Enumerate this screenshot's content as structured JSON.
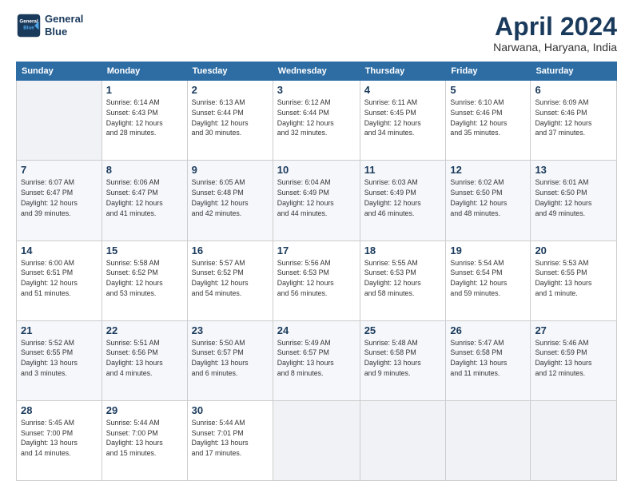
{
  "header": {
    "logo_line1": "General",
    "logo_line2": "Blue",
    "month": "April 2024",
    "location": "Narwana, Haryana, India"
  },
  "weekdays": [
    "Sunday",
    "Monday",
    "Tuesday",
    "Wednesday",
    "Thursday",
    "Friday",
    "Saturday"
  ],
  "weeks": [
    [
      {
        "day": "",
        "info": ""
      },
      {
        "day": "1",
        "info": "Sunrise: 6:14 AM\nSunset: 6:43 PM\nDaylight: 12 hours\nand 28 minutes."
      },
      {
        "day": "2",
        "info": "Sunrise: 6:13 AM\nSunset: 6:44 PM\nDaylight: 12 hours\nand 30 minutes."
      },
      {
        "day": "3",
        "info": "Sunrise: 6:12 AM\nSunset: 6:44 PM\nDaylight: 12 hours\nand 32 minutes."
      },
      {
        "day": "4",
        "info": "Sunrise: 6:11 AM\nSunset: 6:45 PM\nDaylight: 12 hours\nand 34 minutes."
      },
      {
        "day": "5",
        "info": "Sunrise: 6:10 AM\nSunset: 6:46 PM\nDaylight: 12 hours\nand 35 minutes."
      },
      {
        "day": "6",
        "info": "Sunrise: 6:09 AM\nSunset: 6:46 PM\nDaylight: 12 hours\nand 37 minutes."
      }
    ],
    [
      {
        "day": "7",
        "info": "Sunrise: 6:07 AM\nSunset: 6:47 PM\nDaylight: 12 hours\nand 39 minutes."
      },
      {
        "day": "8",
        "info": "Sunrise: 6:06 AM\nSunset: 6:47 PM\nDaylight: 12 hours\nand 41 minutes."
      },
      {
        "day": "9",
        "info": "Sunrise: 6:05 AM\nSunset: 6:48 PM\nDaylight: 12 hours\nand 42 minutes."
      },
      {
        "day": "10",
        "info": "Sunrise: 6:04 AM\nSunset: 6:49 PM\nDaylight: 12 hours\nand 44 minutes."
      },
      {
        "day": "11",
        "info": "Sunrise: 6:03 AM\nSunset: 6:49 PM\nDaylight: 12 hours\nand 46 minutes."
      },
      {
        "day": "12",
        "info": "Sunrise: 6:02 AM\nSunset: 6:50 PM\nDaylight: 12 hours\nand 48 minutes."
      },
      {
        "day": "13",
        "info": "Sunrise: 6:01 AM\nSunset: 6:50 PM\nDaylight: 12 hours\nand 49 minutes."
      }
    ],
    [
      {
        "day": "14",
        "info": "Sunrise: 6:00 AM\nSunset: 6:51 PM\nDaylight: 12 hours\nand 51 minutes."
      },
      {
        "day": "15",
        "info": "Sunrise: 5:58 AM\nSunset: 6:52 PM\nDaylight: 12 hours\nand 53 minutes."
      },
      {
        "day": "16",
        "info": "Sunrise: 5:57 AM\nSunset: 6:52 PM\nDaylight: 12 hours\nand 54 minutes."
      },
      {
        "day": "17",
        "info": "Sunrise: 5:56 AM\nSunset: 6:53 PM\nDaylight: 12 hours\nand 56 minutes."
      },
      {
        "day": "18",
        "info": "Sunrise: 5:55 AM\nSunset: 6:53 PM\nDaylight: 12 hours\nand 58 minutes."
      },
      {
        "day": "19",
        "info": "Sunrise: 5:54 AM\nSunset: 6:54 PM\nDaylight: 12 hours\nand 59 minutes."
      },
      {
        "day": "20",
        "info": "Sunrise: 5:53 AM\nSunset: 6:55 PM\nDaylight: 13 hours\nand 1 minute."
      }
    ],
    [
      {
        "day": "21",
        "info": "Sunrise: 5:52 AM\nSunset: 6:55 PM\nDaylight: 13 hours\nand 3 minutes."
      },
      {
        "day": "22",
        "info": "Sunrise: 5:51 AM\nSunset: 6:56 PM\nDaylight: 13 hours\nand 4 minutes."
      },
      {
        "day": "23",
        "info": "Sunrise: 5:50 AM\nSunset: 6:57 PM\nDaylight: 13 hours\nand 6 minutes."
      },
      {
        "day": "24",
        "info": "Sunrise: 5:49 AM\nSunset: 6:57 PM\nDaylight: 13 hours\nand 8 minutes."
      },
      {
        "day": "25",
        "info": "Sunrise: 5:48 AM\nSunset: 6:58 PM\nDaylight: 13 hours\nand 9 minutes."
      },
      {
        "day": "26",
        "info": "Sunrise: 5:47 AM\nSunset: 6:58 PM\nDaylight: 13 hours\nand 11 minutes."
      },
      {
        "day": "27",
        "info": "Sunrise: 5:46 AM\nSunset: 6:59 PM\nDaylight: 13 hours\nand 12 minutes."
      }
    ],
    [
      {
        "day": "28",
        "info": "Sunrise: 5:45 AM\nSunset: 7:00 PM\nDaylight: 13 hours\nand 14 minutes."
      },
      {
        "day": "29",
        "info": "Sunrise: 5:44 AM\nSunset: 7:00 PM\nDaylight: 13 hours\nand 15 minutes."
      },
      {
        "day": "30",
        "info": "Sunrise: 5:44 AM\nSunset: 7:01 PM\nDaylight: 13 hours\nand 17 minutes."
      },
      {
        "day": "",
        "info": ""
      },
      {
        "day": "",
        "info": ""
      },
      {
        "day": "",
        "info": ""
      },
      {
        "day": "",
        "info": ""
      }
    ]
  ]
}
